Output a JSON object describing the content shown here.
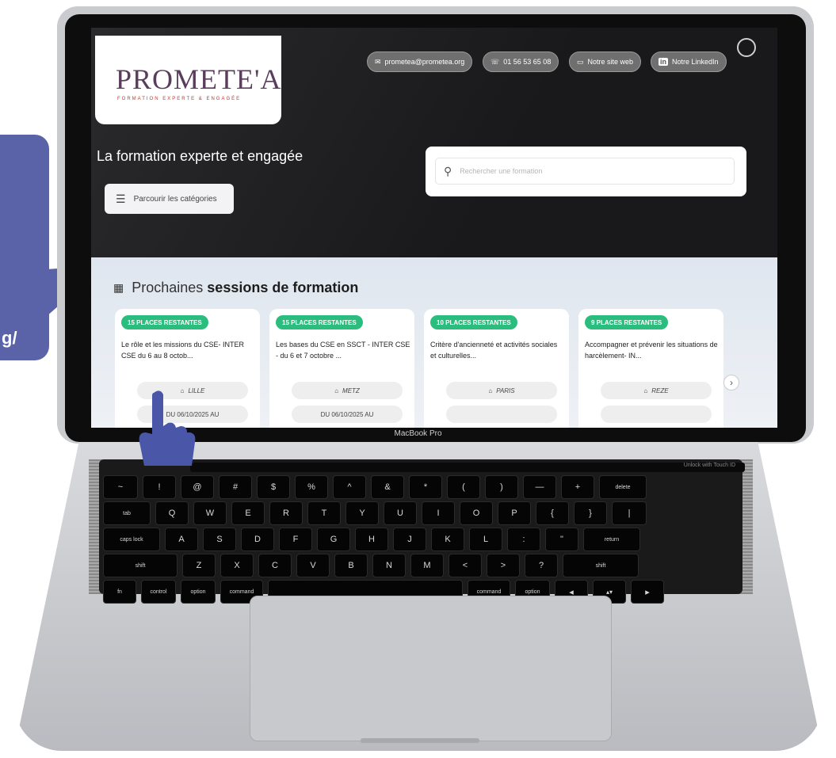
{
  "bubble": {
    "text": "g/"
  },
  "laptop": {
    "model_label": "MacBook Pro",
    "touchbar_text": "Unlock with Touch ID",
    "keyboard": {
      "row1": [
        "~",
        "!",
        "@",
        "#",
        "$",
        "%",
        "^",
        "&",
        "*",
        "(",
        ")",
        "—",
        "+",
        "delete"
      ],
      "row2": [
        "tab",
        "Q",
        "W",
        "E",
        "R",
        "T",
        "Y",
        "U",
        "I",
        "O",
        "P",
        "{",
        "}",
        "|"
      ],
      "row3": [
        "caps lock",
        "A",
        "S",
        "D",
        "F",
        "G",
        "H",
        "J",
        "K",
        "L",
        ":",
        "\"",
        "return"
      ],
      "row4": [
        "shift",
        "Z",
        "X",
        "C",
        "V",
        "B",
        "N",
        "M",
        "<",
        ">",
        "?",
        "shift"
      ],
      "row5": [
        "fn",
        "control",
        "option",
        "command",
        "",
        "command",
        "option",
        "◂",
        "▴▾",
        "▸"
      ]
    }
  },
  "site": {
    "logo": {
      "name": "PROMETE'A",
      "subtitle": "FORMATION EXPERTE & ENGAGÉE"
    },
    "contacts": [
      {
        "icon": "mail-icon",
        "label": "prometea@prometea.org"
      },
      {
        "icon": "phone-icon",
        "label": "01 56 53 65 08"
      },
      {
        "icon": "monitor-icon",
        "label": "Notre site web"
      },
      {
        "icon": "linkedin-icon",
        "label": "Notre LinkedIn"
      }
    ],
    "tagline": "La formation experte et engagée",
    "categories_button": "Parcourir les catégories",
    "search_placeholder": "Rechercher une formation",
    "sessions_title_prefix": "Prochaines ",
    "sessions_title_bold": "sessions de formation",
    "cards": [
      {
        "badge": "15 PLACES RESTANTES",
        "title": "Le rôle et les missions du CSE- INTER CSE du 6 au 8 octob...",
        "city": "LILLE",
        "date": "DU 06/10/2025 AU"
      },
      {
        "badge": "15 PLACES RESTANTES",
        "title": "Les bases du CSE en SSCT - INTER CSE - du 6 et 7 octobre ...",
        "city": "METZ",
        "date": "DU 06/10/2025 AU"
      },
      {
        "badge": "10 PLACES RESTANTES",
        "title": "Critère d'ancienneté et activités sociales et culturelles...",
        "city": "PARIS",
        "date": ""
      },
      {
        "badge": "9 PLACES RESTANTES",
        "title": "Accompagner et prévenir les situations de harcèlement- IN...",
        "city": "REZE",
        "date": ""
      }
    ],
    "colors": {
      "badge": "#2bbd7e",
      "bubble": "#5b63a8",
      "hand": "#4a57a8"
    }
  }
}
